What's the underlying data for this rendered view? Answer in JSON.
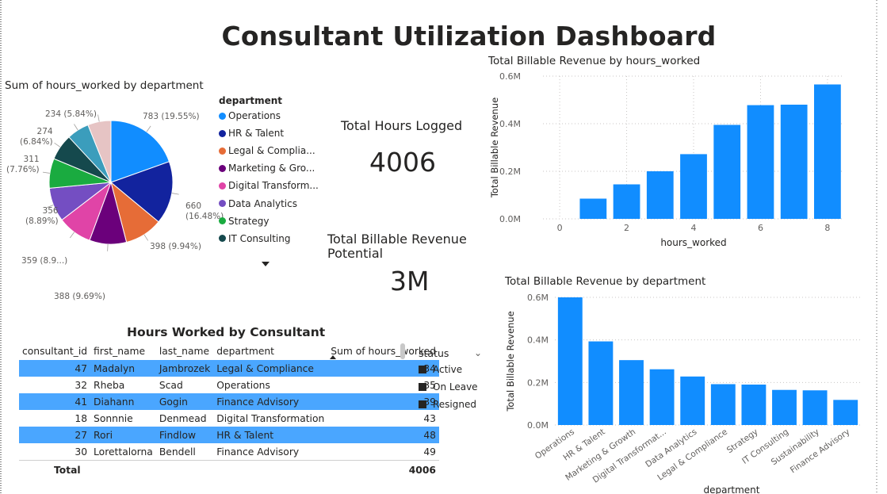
{
  "dashboard": {
    "title": "Consultant Utilization Dashboard"
  },
  "pie": {
    "title": "Sum of hours_worked by department",
    "legend_title": "department",
    "legend": [
      {
        "label": "Operations",
        "color": "#118dff"
      },
      {
        "label": "HR & Talent",
        "color": "#12239e"
      },
      {
        "label": "Legal & Complia...",
        "color": "#e66c37"
      },
      {
        "label": "Marketing & Gro...",
        "color": "#6b007b"
      },
      {
        "label": "Digital Transform...",
        "color": "#e044a7"
      },
      {
        "label": "Data Analytics",
        "color": "#744ec2"
      },
      {
        "label": "Strategy",
        "color": "#1aab40"
      },
      {
        "label": "IT Consulting",
        "color": "#15494d"
      }
    ],
    "labels": [
      {
        "l1": "783 (19.55%)"
      },
      {
        "l1": "660",
        "l2": "(16.48%)"
      },
      {
        "l1": "398 (9.94%)"
      },
      {
        "l1": "388 (9.69%)"
      },
      {
        "l1": "359 (8.9...)"
      },
      {
        "l1": "356",
        "l2": "(8.89%)"
      },
      {
        "l1": "311",
        "l2": "(7.76%)"
      },
      {
        "l1": "274",
        "l2": "(6.84%)"
      },
      {
        "l1": "234 (5.84%)"
      }
    ]
  },
  "chart_data": [
    {
      "type": "pie",
      "title": "Sum of hours_worked by department",
      "categories": [
        "Operations",
        "HR & Talent",
        "Legal & Compliance",
        "Marketing & Growth",
        "Digital Transformation",
        "Data Analytics",
        "Strategy",
        "IT Consulting",
        "Sustainability",
        "Finance Advisory"
      ],
      "values": [
        783,
        660,
        398,
        388,
        359,
        356,
        311,
        274,
        234,
        243
      ],
      "colors": [
        "#118dff",
        "#12239e",
        "#e66c37",
        "#6b007b",
        "#e044a7",
        "#744ec2",
        "#1aab40",
        "#15494d",
        "#3b9dbc",
        "#e6c4c4"
      ]
    },
    {
      "type": "bar",
      "title": "Total Billable Revenue by hours_worked",
      "xlabel": "hours_worked",
      "ylabel": "Total Billable Revenue",
      "x": [
        1,
        2,
        3,
        4,
        5,
        6,
        7,
        8
      ],
      "values": [
        85000,
        145000,
        200000,
        272000,
        395000,
        478000,
        480000,
        565000
      ],
      "xlim": [
        -0.5,
        8.5
      ],
      "ylim": [
        0,
        600000
      ],
      "yticks": [
        "0.0M",
        "0.2M",
        "0.4M",
        "0.6M"
      ],
      "xticks": [
        "0",
        "2",
        "4",
        "6",
        "8"
      ],
      "color": "#118dff"
    },
    {
      "type": "bar",
      "title": "Total Billable Revenue by department",
      "xlabel": "department",
      "ylabel": "Total Billable Revenue",
      "categories": [
        "Operations",
        "HR & Talent",
        "Marketing & Growth",
        "Digital Transformat...",
        "Data Analytics",
        "Legal & Compliance",
        "Strategy",
        "IT Consulting",
        "Sustainability",
        "Finance Advisory"
      ],
      "values": [
        600000,
        393000,
        305000,
        262000,
        228000,
        192000,
        190000,
        165000,
        163000,
        118000
      ],
      "ylim": [
        0,
        600000
      ],
      "yticks": [
        "0.0M",
        "0.2M",
        "0.4M",
        "0.6M"
      ],
      "color": "#118dff"
    }
  ],
  "cards": {
    "hours_label": "Total Hours Logged",
    "hours_value": "4006",
    "revenue_label_1": "Total Billable Revenue",
    "revenue_label_2": "Potential",
    "revenue_value": "3M"
  },
  "table": {
    "title": "Hours Worked by Consultant",
    "headers": [
      "consultant_id",
      "first_name",
      "last_name",
      "department",
      "Sum of hours_worked"
    ],
    "rows": [
      [
        "47",
        "Madalyn",
        "Jambrozek",
        "Legal & Compliance",
        "34"
      ],
      [
        "32",
        "Rheba",
        "Scad",
        "Operations",
        "35"
      ],
      [
        "41",
        "Diahann",
        "Gogin",
        "Finance Advisory",
        "39"
      ],
      [
        "18",
        "Sonnnie",
        "Denmead",
        "Digital Transformation",
        "43"
      ],
      [
        "27",
        "Rori",
        "Findlow",
        "HR & Talent",
        "48"
      ],
      [
        "30",
        "Lorettalorna",
        "Bendell",
        "Finance Advisory",
        "49"
      ]
    ],
    "total_label": "Total",
    "total_value": "4006"
  },
  "slicer": {
    "title": "status",
    "items": [
      "Active",
      "On Leave",
      "Resigned"
    ]
  }
}
